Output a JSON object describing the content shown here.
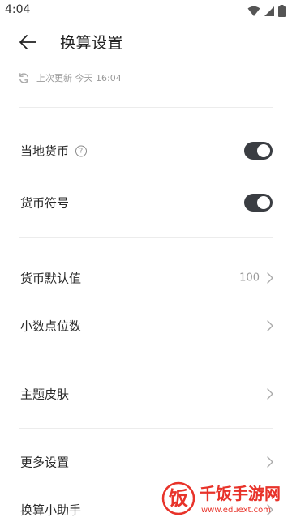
{
  "status_bar": {
    "time": "4:04",
    "icons": [
      "wifi-icon",
      "signal-icon",
      "battery-icon"
    ]
  },
  "header": {
    "title": "换算设置",
    "back_icon": "arrow-left-icon"
  },
  "update": {
    "icon": "refresh-icon",
    "text": "上次更新 今天 16:04"
  },
  "settings": {
    "local_currency": {
      "label": "当地货币",
      "help_icon": "?",
      "enabled": true
    },
    "currency_symbol": {
      "label": "货币符号",
      "enabled": true
    },
    "default_value": {
      "label": "货币默认值",
      "value": "100"
    },
    "decimal_places": {
      "label": "小数点位数"
    },
    "theme_skin": {
      "label": "主题皮肤"
    },
    "more_settings": {
      "label": "更多设置"
    },
    "assistant": {
      "label": "换算小助手"
    }
  },
  "watermark": {
    "name": "千饭手游网",
    "url": "www.eduext.com",
    "logo_char": "饭"
  },
  "colors": {
    "toggle_on": "#3a3d42",
    "watermark_red": "#e8332a",
    "divider": "#ececec",
    "muted_text": "#9a9a9a"
  }
}
